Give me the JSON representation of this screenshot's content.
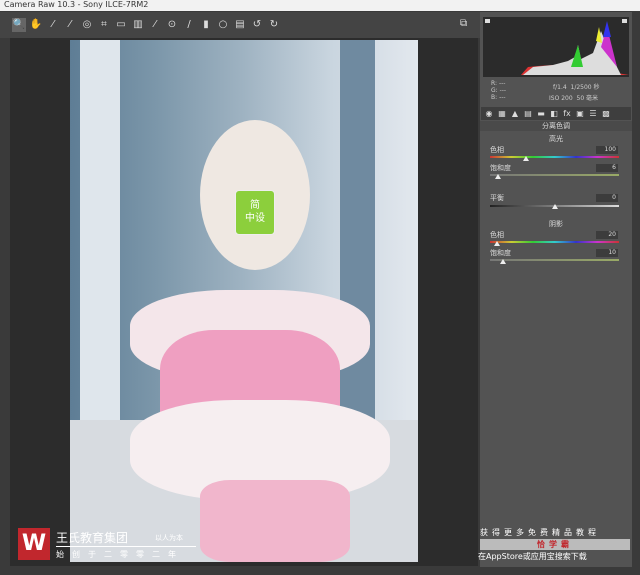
{
  "title": "Camera Raw 10.3  -  Sony ILCE-7RM2",
  "toolbar": {
    "tools": [
      "zoom-icon",
      "hand-icon",
      "white-balance-icon",
      "color-sampler-icon",
      "target-adjust-icon",
      "crop-icon",
      "straighten-icon",
      "transform-icon",
      "spot-removal-icon",
      "red-eye-icon",
      "adjustment-brush-icon",
      "graduated-filter-icon",
      "radial-filter-icon",
      "preferences-icon",
      "rotate-left-icon",
      "rotate-right-icon"
    ],
    "glyphs": [
      "🔍",
      "✋",
      "⁄",
      "⁄",
      "◎",
      "⌗",
      "▭",
      "▥",
      "⁄",
      "⊙",
      "/",
      "▮",
      "○",
      "▤",
      "↺",
      "↻"
    ]
  },
  "info": {
    "r": "R:",
    "g": "G:",
    "b": "B:",
    "dash": "---",
    "aperture": "f/1.4",
    "shutter": "1/2500 秒",
    "iso": "ISO 200",
    "focal": "50 毫米"
  },
  "tabs": [
    "◉",
    "▦",
    "▲",
    "▤",
    "▬",
    "◧",
    "fx",
    "▣",
    "☰",
    "▩"
  ],
  "panel": {
    "title": "分离色调",
    "highlights": "高光",
    "hl_hue_label": "色相",
    "hl_hue": "100",
    "hl_sat_label": "饱和度",
    "hl_sat": "6",
    "balance_label": "平衡",
    "balance": "0",
    "shadows": "阴影",
    "sh_hue_label": "色相",
    "sh_hue": "20",
    "sh_sat_label": "饱和度",
    "sh_sat": "10"
  },
  "sliders": {
    "hl_hue": 100,
    "hl_sat": 6,
    "balance": 0,
    "sh_hue": 20,
    "sh_sat": 10
  },
  "photo_badge": {
    "line1": "简",
    "line2": "中设"
  },
  "watermark": {
    "logo": "W",
    "name": "王氏教育集团",
    "slogan": "以人为本",
    "since": "始创于二零零二年",
    "r1": "获得更多免费精品教程",
    "r2": "恰学霸",
    "r3": "在AppStore或应用宝搜索下载"
  }
}
